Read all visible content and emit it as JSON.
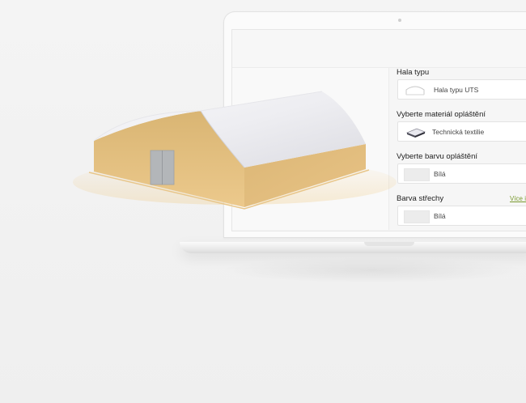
{
  "config": {
    "hall_type": {
      "label": "Hala typu",
      "value": "Hala typu UTS",
      "icon": "hall-outline-icon"
    },
    "material": {
      "label": "Vyberte materiál opláštění",
      "value": "Technická textilie",
      "icon": "textile-swatch-icon"
    },
    "cladding_color": {
      "label": "Vyberte barvu opláštění",
      "value": "Bílá",
      "swatch": "#ececec"
    },
    "roof_color": {
      "label": "Barva střechy",
      "value": "Bílá",
      "more_link": "Více i",
      "swatch": "#ececec"
    }
  },
  "colors": {
    "accent_link": "#7a9a2f",
    "hall_walls": "#e3bf7e",
    "hall_roof": "#f4f4f6",
    "door": "#b3b6b9"
  }
}
